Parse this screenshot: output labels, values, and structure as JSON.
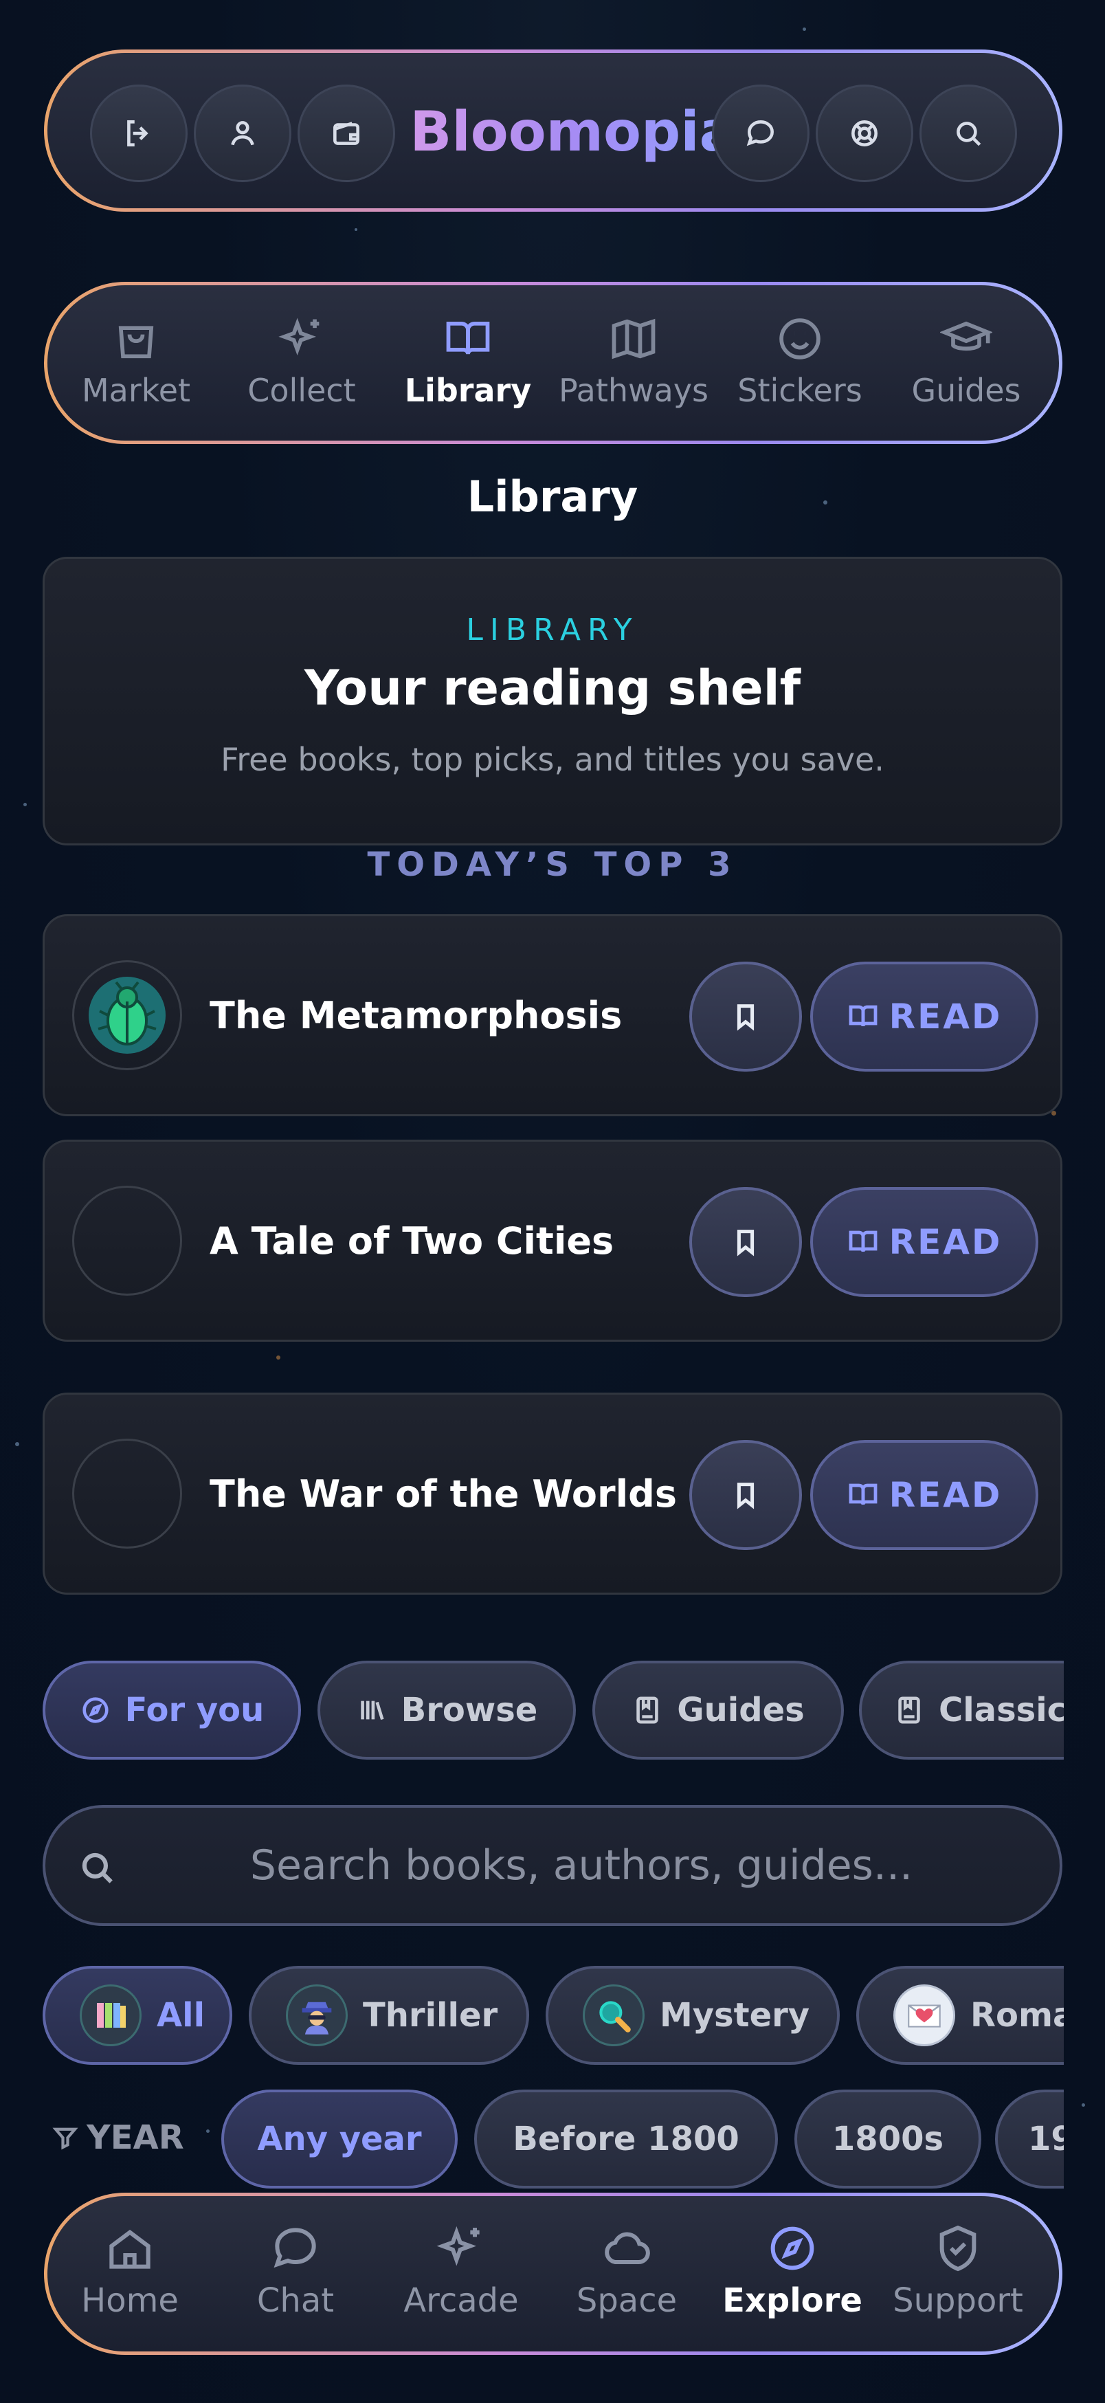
{
  "app": {
    "brand": "Bloomopia"
  },
  "topbar": {
    "left_icons": [
      "logout-icon",
      "user-icon",
      "wallet-icon"
    ],
    "right_icons": [
      "chat-bubble-icon",
      "lifebuoy-icon",
      "search-icon"
    ]
  },
  "categories": [
    {
      "label": "Market",
      "icon": "shopping-bag-icon",
      "active": false
    },
    {
      "label": "Collect",
      "icon": "sparkles-icon",
      "active": false
    },
    {
      "label": "Library",
      "icon": "open-book-icon",
      "active": true
    },
    {
      "label": "Pathways",
      "icon": "map-icon",
      "active": false
    },
    {
      "label": "Stickers",
      "icon": "smiley-icon",
      "active": false
    },
    {
      "label": "Guides",
      "icon": "graduation-cap-icon",
      "active": false
    }
  ],
  "page": {
    "title": "Library"
  },
  "hero": {
    "kicker": "LIBRARY",
    "title": "Your reading shelf",
    "subtitle": "Free books, top picks, and titles you save."
  },
  "top3": {
    "label": "TODAY’S TOP 3",
    "books": [
      {
        "title": "The Metamorphosis",
        "cover": "beetle-icon",
        "read_label": "READ"
      },
      {
        "title": "A Tale of Two Cities",
        "cover": "",
        "read_label": "READ"
      },
      {
        "title": "The War of the Worlds",
        "cover": "",
        "read_label": "READ"
      }
    ]
  },
  "tabs": [
    {
      "label": "For you",
      "icon": "compass-icon",
      "active": true
    },
    {
      "label": "Browse",
      "icon": "bookshelf-icon",
      "active": false
    },
    {
      "label": "Guides",
      "icon": "guide-book-icon",
      "active": false
    },
    {
      "label": "Classic",
      "icon": "classic-book-icon",
      "active": false
    }
  ],
  "search": {
    "placeholder": "Search books, authors, guides..."
  },
  "genres": [
    {
      "label": "All",
      "icon": "books-stack-icon",
      "active": true
    },
    {
      "label": "Thriller",
      "icon": "spy-icon",
      "active": false
    },
    {
      "label": "Mystery",
      "icon": "magnifier-icon",
      "active": false
    },
    {
      "label": "Roma",
      "icon": "love-letter-icon",
      "active": false
    }
  ],
  "year_filter": {
    "label": "YEAR",
    "options": [
      {
        "label": "Any year",
        "active": true
      },
      {
        "label": "Before 1800",
        "active": false
      },
      {
        "label": "1800s",
        "active": false
      },
      {
        "label": "19",
        "active": false
      }
    ]
  },
  "bottom_nav": [
    {
      "label": "Home",
      "icon": "home-icon",
      "active": false
    },
    {
      "label": "Chat",
      "icon": "chat-icon",
      "active": false
    },
    {
      "label": "Arcade",
      "icon": "sparkle-icon",
      "active": false
    },
    {
      "label": "Space",
      "icon": "cloud-icon",
      "active": false
    },
    {
      "label": "Explore",
      "icon": "compass-icon",
      "active": true
    },
    {
      "label": "Support",
      "icon": "shield-check-icon",
      "active": false
    }
  ],
  "colors": {
    "accent": "#8f9cff",
    "cyan": "#2bd0e0",
    "background": "#081222"
  }
}
